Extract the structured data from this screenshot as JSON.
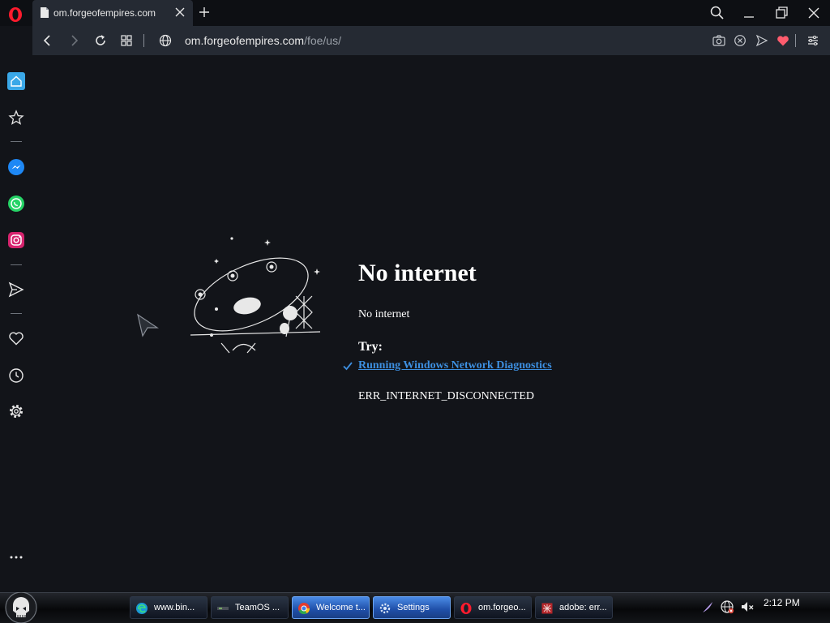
{
  "browser": {
    "tab": {
      "title": "om.forgeofempires.com"
    },
    "url": {
      "domain": "om.forgeofempires.com",
      "path": "/foe/us/"
    }
  },
  "sidebar": {
    "items": [
      "home-icon",
      "star-icon",
      "messenger-icon",
      "whatsapp-icon",
      "instagram-icon",
      "send-icon",
      "heart-icon",
      "history-icon",
      "gear-icon",
      "more-icon"
    ]
  },
  "error_page": {
    "title": "No internet",
    "subtitle": "No internet",
    "try_label": "Try:",
    "suggestion_link": "Running Windows Network Diagnostics",
    "error_code": "ERR_INTERNET_DISCONNECTED"
  },
  "taskbar": {
    "buttons": [
      {
        "label": "www.bin...",
        "icon": "edge-icon"
      },
      {
        "label": "TeamOS ...",
        "icon": "teamos-icon"
      },
      {
        "label": "Welcome t...",
        "icon": "chrome-icon",
        "active": true
      },
      {
        "label": "Settings",
        "icon": "settings-icon",
        "active": true
      },
      {
        "label": "om.forgeo...",
        "icon": "opera-icon"
      },
      {
        "label": "adobe: err...",
        "icon": "app-icon"
      }
    ],
    "clock": "2:12 PM"
  },
  "colors": {
    "accent": "#3d8fe0",
    "page_bg": "#121419",
    "toolbar_bg": "#252a33",
    "opera_red": "#ff1b2d",
    "heart": "#ff5c6e"
  }
}
